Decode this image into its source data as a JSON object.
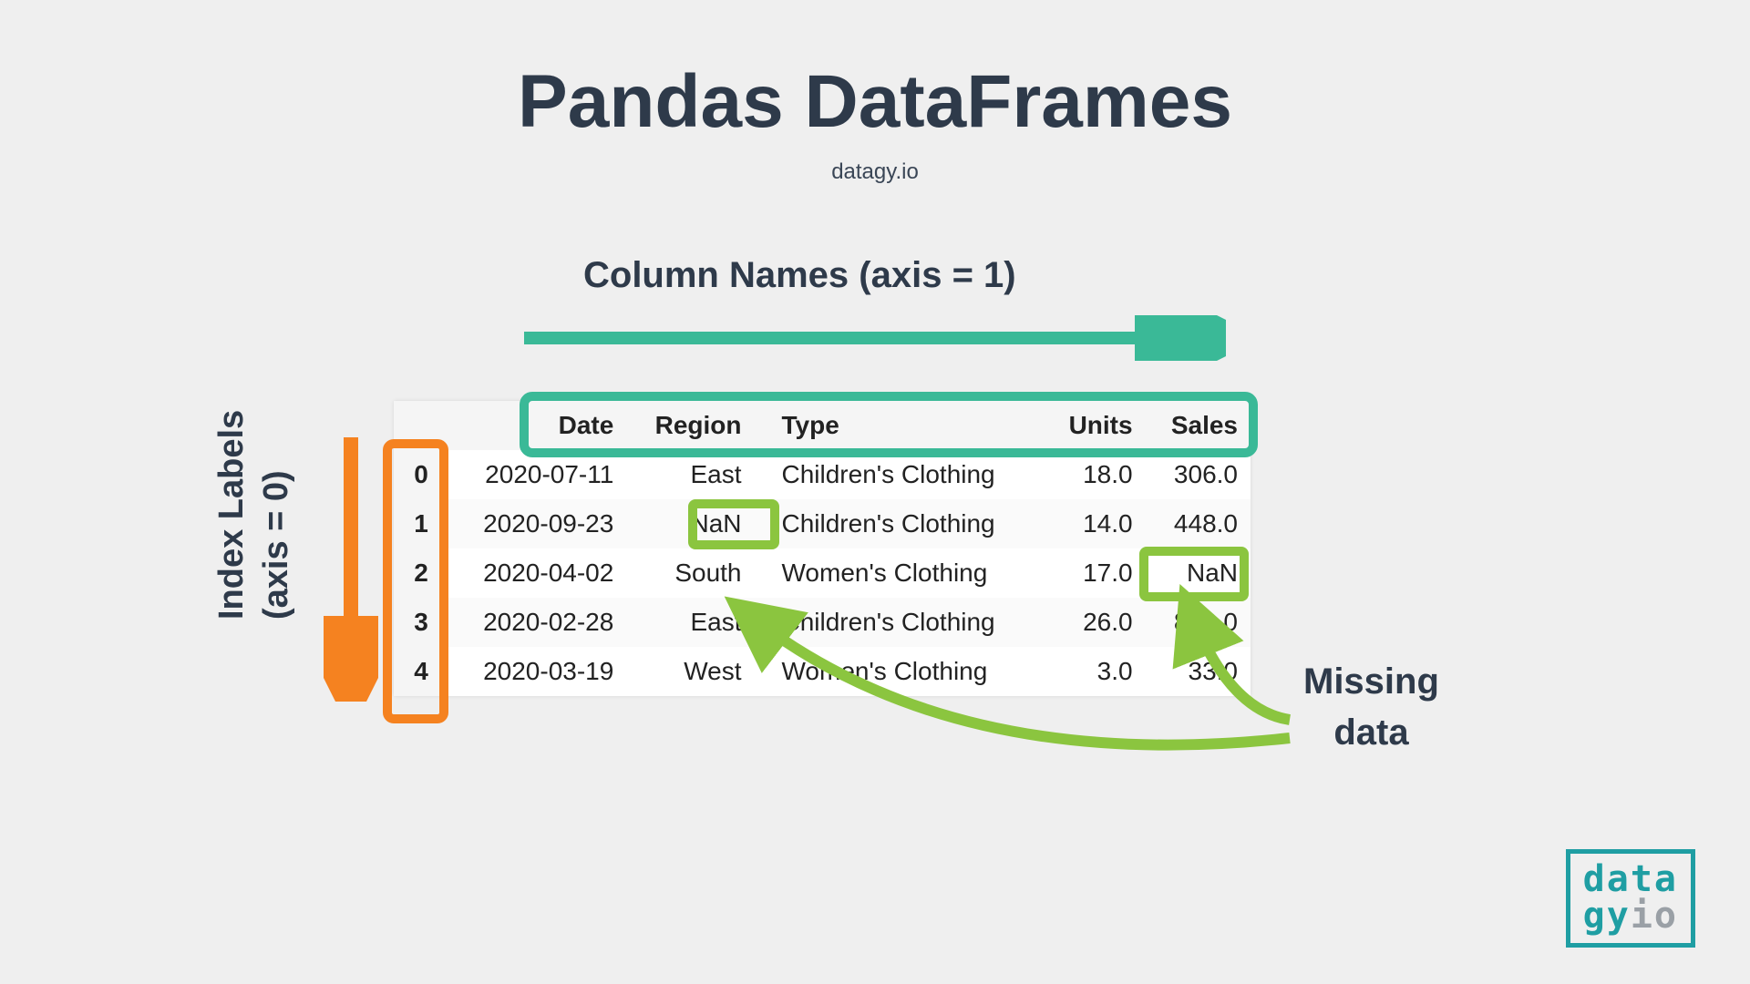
{
  "title": "Pandas DataFrames",
  "subtitle": "datagy.io",
  "labels": {
    "column_names": "Column Names (axis = 1)",
    "index_labels": "Index Labels",
    "axis0": "(axis = 0)",
    "missing_line1": "Missing",
    "missing_line2": "data"
  },
  "table": {
    "columns": [
      "Date",
      "Region",
      "Type",
      "Units",
      "Sales"
    ],
    "rows": [
      {
        "idx": "0",
        "Date": "2020-07-11",
        "Region": "East",
        "Type": "Children's Clothing",
        "Units": "18.0",
        "Sales": "306.0"
      },
      {
        "idx": "1",
        "Date": "2020-09-23",
        "Region": "NaN",
        "Type": "Children's Clothing",
        "Units": "14.0",
        "Sales": "448.0"
      },
      {
        "idx": "2",
        "Date": "2020-04-02",
        "Region": "South",
        "Type": "Women's Clothing",
        "Units": "17.0",
        "Sales": "NaN"
      },
      {
        "idx": "3",
        "Date": "2020-02-28",
        "Region": "East",
        "Type": "Children's Clothing",
        "Units": "26.0",
        "Sales": "832.0"
      },
      {
        "idx": "4",
        "Date": "2020-03-19",
        "Region": "West",
        "Type": "Women's Clothing",
        "Units": "3.0",
        "Sales": "33.0"
      }
    ]
  },
  "logo": {
    "line1": "data",
    "line2a": "gy",
    "line2b": "io"
  }
}
